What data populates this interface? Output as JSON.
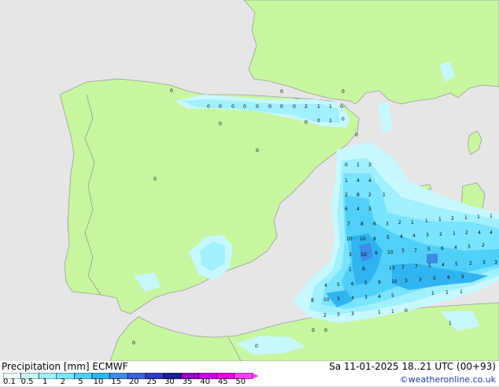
{
  "header": {
    "product_label": "Precipitation [mm]",
    "model": "ECMWF",
    "valid_time": "Sa 11-01-2025 18..21 UTC (00+93)",
    "credit": "©weatheronline.co.uk"
  },
  "legend": {
    "ticks": [
      "0.1",
      "0.5",
      "1",
      "2",
      "5",
      "10",
      "15",
      "20",
      "25",
      "30",
      "35",
      "40",
      "45",
      "50"
    ],
    "colors": [
      "#f0ffff",
      "#c8f8ff",
      "#a0f0ff",
      "#78e4ff",
      "#50d0f8",
      "#30b4f0",
      "#3c8ce8",
      "#3c64d8",
      "#2d3cc4",
      "#1e1e96",
      "#9600c8",
      "#c800e6",
      "#e600e6",
      "#ff3cff"
    ]
  },
  "colors": {
    "sea": "#e6e6e6",
    "land": "#c8f5a0",
    "coast": "#9a9a9a",
    "border": "#8c8c8c"
  },
  "map_values": [
    "0",
    "0",
    "0",
    "0",
    "0",
    "0",
    "0",
    "0",
    "0",
    "0",
    "0",
    "2",
    "1",
    "1",
    "0",
    "0",
    "0",
    "1",
    "0",
    "0",
    "0",
    "0",
    "0",
    "0",
    "1",
    "3",
    "1",
    "4",
    "4",
    "2",
    "8",
    "2",
    "1",
    "6",
    "4",
    "3",
    "7",
    "8",
    "6",
    "3",
    "2",
    "1",
    "1",
    "1",
    "2",
    "1",
    "1",
    "1",
    "10",
    "10",
    "8",
    "5",
    "4",
    "4",
    "3",
    "2",
    "1",
    "2",
    "4",
    "4",
    "3",
    "10",
    "9",
    "10",
    "3",
    "7",
    "5",
    "6",
    "4",
    "3",
    "2",
    "1",
    "6",
    "13",
    "7",
    "7",
    "5",
    "4",
    "5",
    "2",
    "3",
    "3",
    "4",
    "5",
    "6",
    "5",
    "9",
    "10",
    "3",
    "3",
    "5",
    "6",
    "5",
    "8",
    "10",
    "3",
    "4",
    "3",
    "4",
    "5",
    "1",
    "1",
    "1",
    "2",
    "3",
    "3",
    "1",
    "1",
    "0",
    "0",
    "0",
    "0",
    "0",
    "1"
  ]
}
